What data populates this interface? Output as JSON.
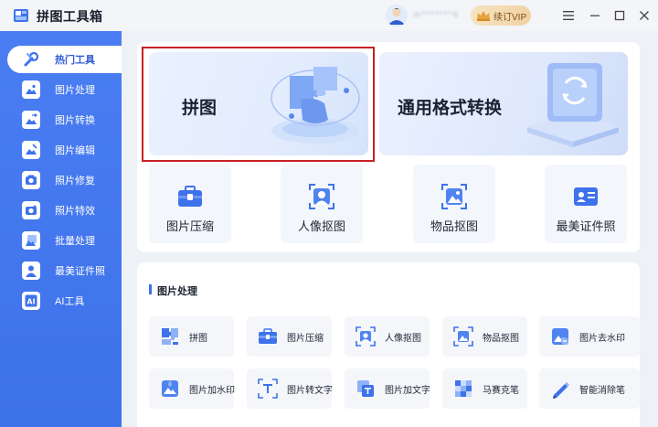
{
  "app": {
    "title": "拼图工具箱",
    "username": "m*******6"
  },
  "titlebar": {
    "vip_label": "续订VIP"
  },
  "sidebar": {
    "items": [
      {
        "label": "热门工具",
        "icon": "wrench-icon"
      },
      {
        "label": "图片处理",
        "icon": "image-icon"
      },
      {
        "label": "图片转换",
        "icon": "image-convert-icon"
      },
      {
        "label": "图片编辑",
        "icon": "image-edit-icon"
      },
      {
        "label": "照片修复",
        "icon": "photo-repair-icon"
      },
      {
        "label": "照片特效",
        "icon": "photo-effect-icon"
      },
      {
        "label": "批量处理",
        "icon": "batch-icon"
      },
      {
        "label": "最美证件照",
        "icon": "id-photo-icon"
      },
      {
        "label": "AI工具",
        "icon": "ai-icon"
      }
    ]
  },
  "banners": [
    {
      "label": "拼图"
    },
    {
      "label": "通用格式转换"
    }
  ],
  "hot_tools": [
    {
      "label": "图片压缩",
      "icon": "compress-icon"
    },
    {
      "label": "人像抠图",
      "icon": "portrait-cutout-icon"
    },
    {
      "label": "物品抠图",
      "icon": "object-cutout-icon"
    },
    {
      "label": "最美证件照",
      "icon": "id-card-icon"
    }
  ],
  "section": {
    "title": "图片处理",
    "tools": [
      {
        "label": "拼图",
        "icon": "puzzle-icon"
      },
      {
        "label": "图片压缩",
        "icon": "compress-icon"
      },
      {
        "label": "人像抠图",
        "icon": "portrait-cutout-icon"
      },
      {
        "label": "物品抠图",
        "icon": "object-cutout-icon"
      },
      {
        "label": "图片去水印",
        "icon": "remove-watermark-icon"
      },
      {
        "label": "图片加水印",
        "icon": "add-watermark-icon"
      },
      {
        "label": "图片转文字",
        "icon": "image-to-text-icon"
      },
      {
        "label": "图片加文字",
        "icon": "add-text-icon"
      },
      {
        "label": "马赛克笔",
        "icon": "mosaic-icon"
      },
      {
        "label": "智能消除笔",
        "icon": "eraser-pen-icon"
      }
    ]
  },
  "colors": {
    "accent": "#3e72ea",
    "highlight": "#c81f26",
    "vip": "#f1d3a3"
  }
}
